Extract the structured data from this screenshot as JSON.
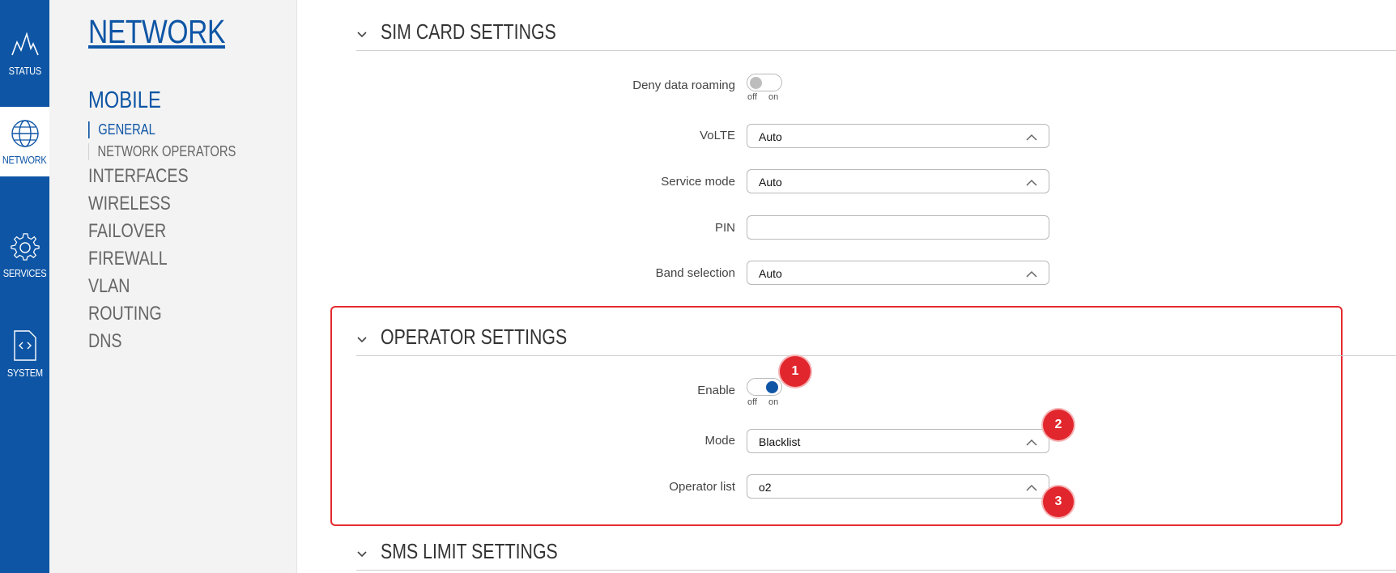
{
  "rail": [
    {
      "label": "STATUS",
      "icon": "pulse-icon"
    },
    {
      "label": "NETWORK",
      "icon": "globe-icon"
    },
    {
      "label": "SERVICES",
      "icon": "gear-icon"
    },
    {
      "label": "SYSTEM",
      "icon": "code-file-icon"
    }
  ],
  "subnav": {
    "title": "NETWORK",
    "section": "MOBILE",
    "sub_items": [
      "GENERAL",
      "NETWORK OPERATORS"
    ],
    "menu": [
      "INTERFACES",
      "WIRELESS",
      "FAILOVER",
      "FIREWALL",
      "VLAN",
      "ROUTING",
      "DNS"
    ]
  },
  "sim": {
    "title": "SIM CARD SETTINGS",
    "deny_roaming_label": "Deny data roaming",
    "toggle_off": "off",
    "toggle_on": "on",
    "volte_label": "VoLTE",
    "volte_value": "Auto",
    "service_mode_label": "Service mode",
    "service_mode_value": "Auto",
    "pin_label": "PIN",
    "pin_value": "",
    "band_label": "Band selection",
    "band_value": "Auto"
  },
  "operator": {
    "title": "OPERATOR SETTINGS",
    "enable_label": "Enable",
    "mode_label": "Mode",
    "mode_value": "Blacklist",
    "list_label": "Operator list",
    "list_value": "o2"
  },
  "sms": {
    "title": "SMS LIMIT SETTINGS"
  },
  "badges": [
    "1",
    "2",
    "3"
  ],
  "colors": {
    "accent": "#0e55a5",
    "highlight": "#e52a2f"
  }
}
